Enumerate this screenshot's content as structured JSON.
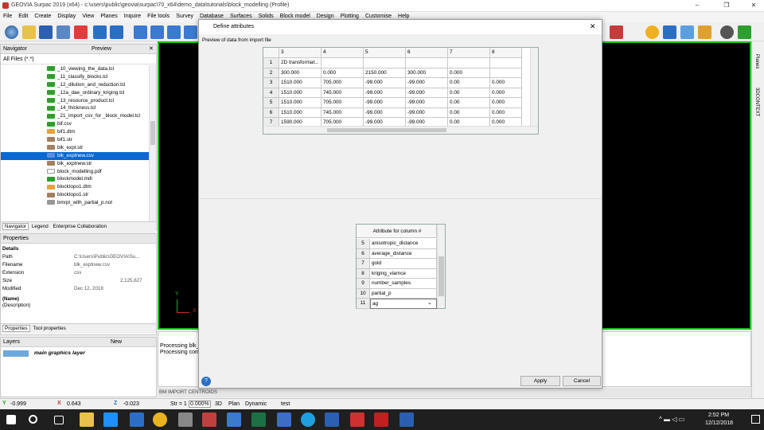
{
  "app": {
    "title": "GEOVIA Surpac 2019 (x64) - c:\\users\\public\\geovia\\surpac\\70_x64\\demo_data\\tutorials\\block_modelling (Profile)",
    "win_min": "–",
    "win_max": "❐",
    "win_close": "✕"
  },
  "menu": [
    "File",
    "Edit",
    "Create",
    "Display",
    "View",
    "Planes",
    "Inquire",
    "File tools",
    "Survey",
    "Database",
    "Surfaces",
    "Solids",
    "Block model",
    "Design",
    "Plotting",
    "Customise",
    "Help"
  ],
  "navigator": {
    "title": "Navigator",
    "preview_label": "Preview",
    "filter": "All Files (*.*)",
    "files": [
      "_10_viewing_the_data.tcl",
      "_11_classify_blocks.tcl",
      "_12_dilution_and_reduction.tcl",
      "_12a_dae_ordinary_kriging.tcl",
      "_13_resource_product.tcl",
      "_14_thickness.tcl",
      "_21_import_csv_for _block_model.tcl",
      "bif.csv",
      "bif1.dtm",
      "bif1.str",
      "blk_expt.str",
      "blk_exptnew.csv",
      "blk_exptnew.str",
      "block_modelling.pdf",
      "blockmodel.mdl",
      "blocktopo1.dtm",
      "blocktopo1.str",
      "bmrpt_with_partial_p.not"
    ],
    "selected_index": 11,
    "tabs": [
      "Navigator",
      "Legend",
      "Enterprise Collaboration"
    ]
  },
  "properties": {
    "title": "Properties",
    "section": "Details",
    "rows": [
      {
        "k": "Path",
        "v": "C:\\Users\\Public\\GEOVIA\\Su..."
      },
      {
        "k": "Filename",
        "v": "blk_exptnew.csv"
      },
      {
        "k": "Extension",
        "v": "csv"
      },
      {
        "k": "Size",
        "v": "2,125,627"
      },
      {
        "k": "Modified",
        "v": "Dec 12, 2018"
      }
    ],
    "name_label": "(Name)",
    "desc_label": "(Description)",
    "tabs": [
      "Properties",
      "Tool properties"
    ]
  },
  "layers": {
    "title": "Layers",
    "new_label": "New",
    "item": "main graphics layer"
  },
  "messages": [
    "Processing blk_e",
    "Processing comp"
  ],
  "dialog": {
    "title": "Define attributes",
    "preview_label": "Preview of data from import file",
    "grid_headers": [
      "",
      "3",
      "4",
      "5",
      "6",
      "7",
      "8"
    ],
    "grid_rows": [
      [
        "1",
        "2D transformat...",
        "",
        "",
        "",
        "",
        ""
      ],
      [
        "2",
        "300.000",
        "0.000",
        "2150.000",
        "300.000",
        "0.000",
        ""
      ],
      [
        "3",
        "1510.000",
        "705.000",
        "-99.000",
        "-99.000",
        "0.00",
        "0.000"
      ],
      [
        "4",
        "1510.000",
        "745.000",
        "-99.000",
        "-99.000",
        "0.00",
        "0.000"
      ],
      [
        "5",
        "1510.000",
        "705.000",
        "-99.000",
        "-99.000",
        "0.00",
        "0.000"
      ],
      [
        "6",
        "1510.000",
        "745.000",
        "-99.000",
        "-99.000",
        "0.00",
        "0.000"
      ],
      [
        "7",
        "1590.000",
        "705.000",
        "-99.000",
        "-99.000",
        "0.00",
        "0.000"
      ]
    ],
    "attr_header": "Attribute for column #",
    "attr_rows": [
      [
        "5",
        "anisotropic_distance"
      ],
      [
        "6",
        "average_distance"
      ],
      [
        "7",
        "gold"
      ],
      [
        "8",
        "kriging_viarnce"
      ],
      [
        "9",
        "number_samples"
      ],
      [
        "10",
        "partial_p"
      ],
      [
        "11",
        "ag"
      ]
    ],
    "apply": "Apply",
    "cancel": "Cancel",
    "help": "?"
  },
  "viewport": {
    "axis_x": "X",
    "axis_y": "Y",
    "bm_label": "BM IMPORT CENTROIDS"
  },
  "right_tabs": [
    "Planes",
    "3DCONTEXT"
  ],
  "status": {
    "y": "-0.999",
    "x": "0.643",
    "z": "-0.023",
    "str_label": "Str = 1",
    "str_val": "0.000%",
    "mode_3d": "3D",
    "plan": "Plan",
    "dynamic": "Dynamic",
    "layer": "test"
  },
  "taskbar": {
    "time": "2:52 PM",
    "date": "12/12/2018"
  },
  "colors": {
    "accent": "#0a68d0",
    "viewport_border": "#1ac21a",
    "taskbar": "#1f1f1f"
  }
}
